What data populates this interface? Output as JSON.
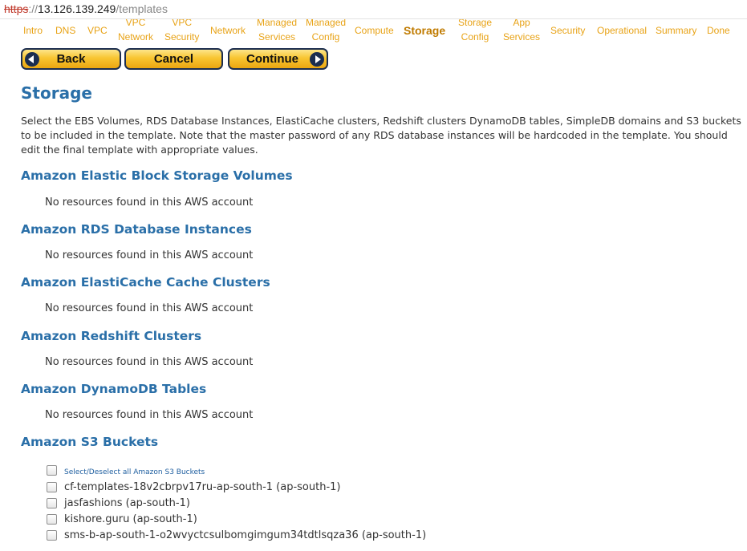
{
  "browser": {
    "url_scheme": "https",
    "url_sep": "://",
    "url_host": "13.126.139.249",
    "url_path": "/templates"
  },
  "steps": [
    {
      "line1": "Intro",
      "line2": ""
    },
    {
      "line1": "DNS",
      "line2": ""
    },
    {
      "line1": "VPC",
      "line2": ""
    },
    {
      "line1": "VPC",
      "line2": "Network"
    },
    {
      "line1": "VPC",
      "line2": "Security"
    },
    {
      "line1": "Network",
      "line2": ""
    },
    {
      "line1": "Managed",
      "line2": "Services"
    },
    {
      "line1": "Managed",
      "line2": "Config"
    },
    {
      "line1": "Compute",
      "line2": ""
    },
    {
      "line1": "Storage",
      "line2": ""
    },
    {
      "line1": "Storage",
      "line2": "Config"
    },
    {
      "line1": "App",
      "line2": "Services"
    },
    {
      "line1": "Security",
      "line2": ""
    },
    {
      "line1": "Operational",
      "line2": ""
    },
    {
      "line1": "Summary",
      "line2": ""
    },
    {
      "line1": "Done",
      "line2": ""
    }
  ],
  "buttons": {
    "back": "Back",
    "cancel": "Cancel",
    "continue": "Continue"
  },
  "page": {
    "title": "Storage",
    "intro": "Select the EBS Volumes, RDS Database Instances, ElastiCache clusters, Redshift clusters DynamoDB tables, SimpleDB domains and S3 buckets to be included in the template. Note that the master password of any RDS database instances will be hardcoded in the template. You should edit the final template with appropriate values."
  },
  "sections": [
    {
      "title": "Amazon Elastic Block Storage Volumes",
      "empty": "No resources found in this AWS account"
    },
    {
      "title": "Amazon RDS Database Instances",
      "empty": "No resources found in this AWS account"
    },
    {
      "title": "Amazon ElastiCache Cache Clusters",
      "empty": "No resources found in this AWS account"
    },
    {
      "title": "Amazon Redshift Clusters",
      "empty": "No resources found in this AWS account"
    },
    {
      "title": "Amazon DynamoDB Tables",
      "empty": "No resources found in this AWS account"
    }
  ],
  "s3": {
    "title": "Amazon S3 Buckets",
    "select_all": "Select/Deselect all Amazon S3 Buckets",
    "buckets": [
      "cf-templates-18v2cbrpv17ru-ap-south-1 (ap-south-1)",
      "jasfashions (ap-south-1)",
      "kishore.guru (ap-south-1)",
      "sms-b-ap-south-1-o2wvyctcsulbomgimgum34tdtlsqza36 (ap-south-1)"
    ]
  },
  "colors": {
    "heading": "#2a6fa8",
    "step": "#e8a317",
    "step_active": "#c07b00",
    "button": "#f8c531"
  }
}
